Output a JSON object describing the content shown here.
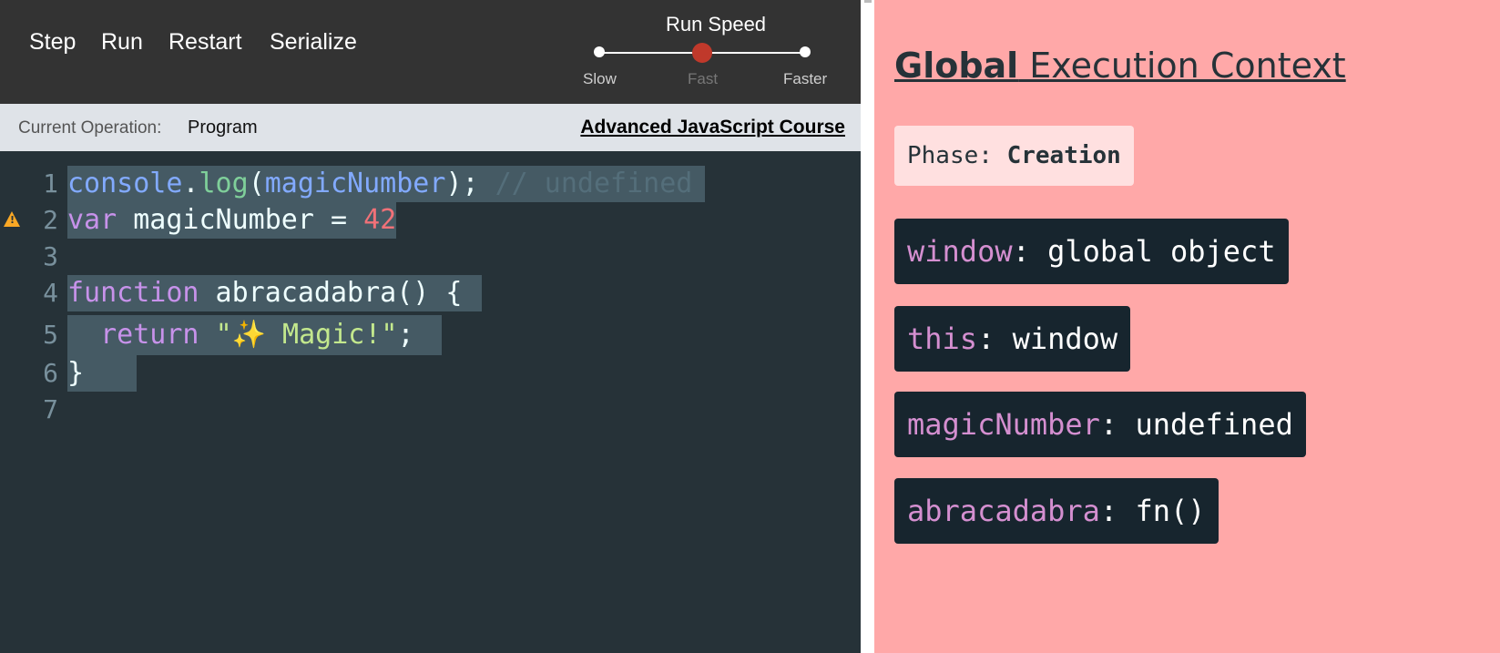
{
  "toolbar": {
    "step_label": "Step",
    "run_label": "Run",
    "restart_label": "Restart",
    "serialize_label": "Serialize"
  },
  "run_speed": {
    "title": "Run Speed",
    "labels": [
      "Slow",
      "Fast",
      "Faster"
    ],
    "selected": "Fast"
  },
  "operation_bar": {
    "label": "Current Operation:",
    "value": "Program",
    "course_link": "Advanced JavaScript Course"
  },
  "editor": {
    "line_numbers": [
      "1",
      "2",
      "3",
      "4",
      "5",
      "6",
      "7"
    ],
    "lines": [
      "console.log(magicNumber); // undefined",
      "var magicNumber = 42",
      "",
      "function abracadabra() {",
      "  return \"✨ Magic!\";",
      "}",
      ""
    ],
    "warning_line": "2"
  },
  "context": {
    "title_bold": "Global",
    "title_rest": " Execution Context",
    "phase_label": "Phase:",
    "phase_value": "Creation",
    "variables": [
      {
        "key": "window",
        "value": ": global object"
      },
      {
        "key": "this",
        "value": ": window"
      },
      {
        "key": "magicNumber",
        "value": ": undefined"
      },
      {
        "key": "abracadabra",
        "value": ": fn()"
      }
    ]
  },
  "colors": {
    "toolbar_bg": "#333333",
    "editor_bg": "#263238",
    "context_bg": "#ffa8a8",
    "slider_knob": "#c0392b",
    "variable_key": "#d48fd0"
  }
}
